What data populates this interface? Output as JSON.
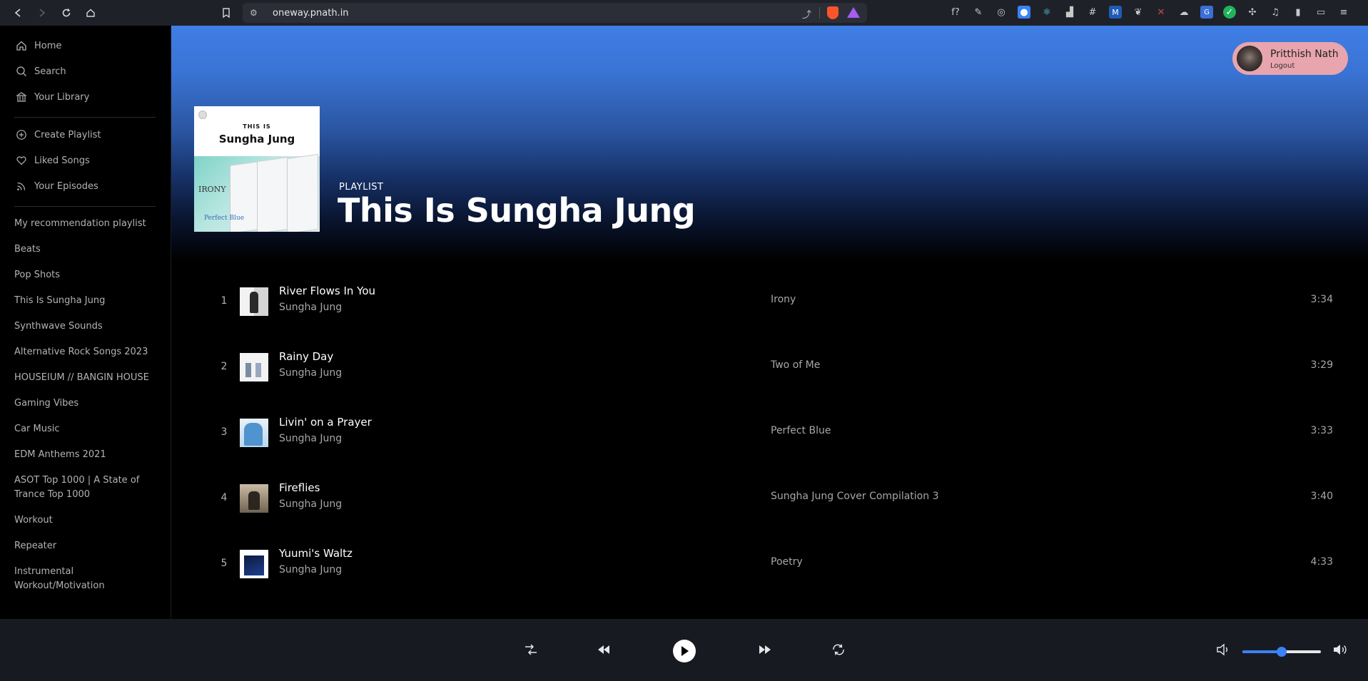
{
  "browser": {
    "url": "oneway.pnath.in"
  },
  "sidebar": {
    "nav": [
      {
        "label": "Home",
        "icon": "home-icon"
      },
      {
        "label": "Search",
        "icon": "search-icon"
      },
      {
        "label": "Your Library",
        "icon": "library-icon"
      }
    ],
    "actions": [
      {
        "label": "Create Playlist",
        "icon": "plus-circle-icon"
      },
      {
        "label": "Liked Songs",
        "icon": "heart-icon"
      },
      {
        "label": "Your Episodes",
        "icon": "rss-icon"
      }
    ],
    "playlists": [
      "My recommendation playlist",
      "Beats",
      "Pop Shots",
      "This Is Sungha Jung",
      "Synthwave Sounds",
      "Alternative Rock Songs 2023",
      "HOUSEIUM // BANGIN HOUSE",
      "Gaming Vibes",
      "Car Music",
      "EDM Anthems 2021",
      "ASOT Top 1000 | A State of Trance Top 1000",
      "Workout",
      "Repeater",
      "Instrumental Workout/Motivation"
    ]
  },
  "user": {
    "name": "Pritthish Nath",
    "logout_label": "Logout"
  },
  "playlist": {
    "type_label": "PLAYLIST",
    "title": "This Is Sungha Jung",
    "cover": {
      "small_text": "THIS IS",
      "big_text": "Sungha Jung",
      "album_text_1": "IRONY",
      "album_text_2": "Perfect Blue"
    }
  },
  "tracks": [
    {
      "num": "1",
      "name": "River Flows In You",
      "artist": "Sungha Jung",
      "album": "Irony",
      "duration": "3:34",
      "thumb_color": "#e9e9e9"
    },
    {
      "num": "2",
      "name": "Rainy Day",
      "artist": "Sungha Jung",
      "album": "Two of Me",
      "duration": "3:29",
      "thumb_color": "#f3f3f3"
    },
    {
      "num": "3",
      "name": "Livin' on a Prayer",
      "artist": "Sungha Jung",
      "album": "Perfect Blue",
      "duration": "3:33",
      "thumb_color": "#7ab3de"
    },
    {
      "num": "4",
      "name": "Fireflies",
      "artist": "Sungha Jung",
      "album": "Sungha Jung Cover Compilation 3",
      "duration": "3:40",
      "thumb_color": "#8a7a62"
    },
    {
      "num": "5",
      "name": "Yuumi's Waltz",
      "artist": "Sungha Jung",
      "album": "Poetry",
      "duration": "4:33",
      "thumb_color": "#16306a"
    }
  ],
  "player": {
    "volume_level": 0.5,
    "accent_color": "#3b82f6"
  },
  "theme": {
    "hero_top": "#3f7ee6",
    "user_pill": "#e8a5ae"
  }
}
